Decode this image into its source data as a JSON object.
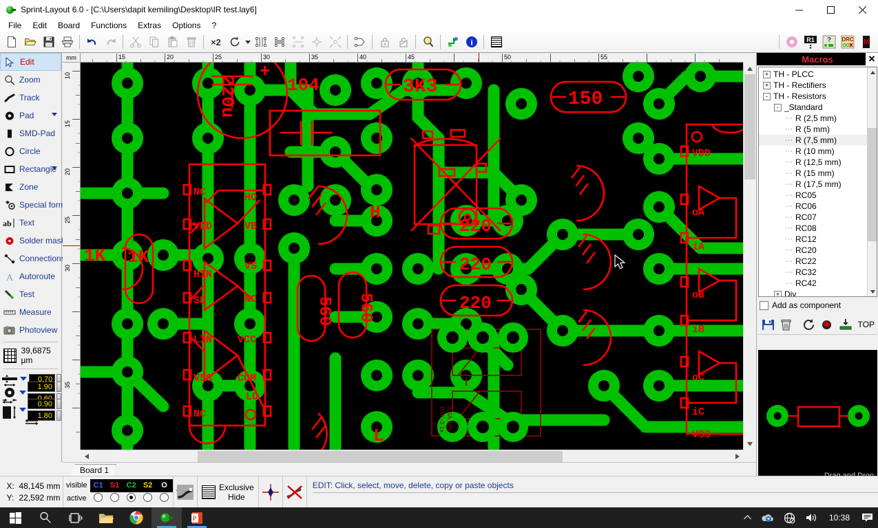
{
  "window": {
    "title": "Sprint-Layout 6.0 - [C:\\Users\\dapit kemiling\\Desktop\\IR test.lay6]",
    "minimize": "–",
    "maximize": "❐",
    "close": "✕"
  },
  "menu": [
    "File",
    "Edit",
    "Board",
    "Functions",
    "Extras",
    "Options",
    "?"
  ],
  "toolbar": {
    "buttons": [
      {
        "name": "new-file-icon",
        "tip": "New"
      },
      {
        "name": "open-file-icon",
        "tip": "Open"
      },
      {
        "name": "save-file-icon",
        "tip": "Save"
      },
      {
        "name": "print-icon",
        "tip": "Print"
      },
      {
        "name": "undo-icon",
        "tip": "Undo"
      },
      {
        "name": "redo-icon",
        "tip": "Redo"
      },
      {
        "name": "cut-icon",
        "tip": "Cut"
      },
      {
        "name": "copy-icon",
        "tip": "Copy"
      },
      {
        "name": "paste-icon",
        "tip": "Paste"
      },
      {
        "name": "delete-icon",
        "tip": "Delete"
      },
      {
        "name": "duplicate-x2-icon",
        "tip": "×2"
      },
      {
        "name": "rotate-icon",
        "tip": "Rotate"
      },
      {
        "name": "mirror-horizontal-icon",
        "tip": "Mirror horizontal"
      },
      {
        "name": "mirror-vertical-icon",
        "tip": "Mirror vertical"
      },
      {
        "name": "align-icon",
        "tip": "Align"
      },
      {
        "name": "flatten-icon",
        "tip": "Flatten"
      },
      {
        "name": "center-icon",
        "tip": "Center"
      },
      {
        "name": "group-icon",
        "tip": "Group"
      },
      {
        "name": "lock-icon",
        "tip": "Lock"
      },
      {
        "name": "unlock-icon",
        "tip": "Unlock"
      },
      {
        "name": "zoom-icon",
        "tip": "Zoom"
      },
      {
        "name": "crop-board-icon",
        "tip": "Board outline"
      },
      {
        "name": "info-icon",
        "tip": "Info"
      },
      {
        "name": "ground-plane-icon",
        "tip": "Ground plane"
      }
    ],
    "right_buttons": [
      {
        "name": "solder-mask-icon",
        "label": ""
      },
      {
        "name": "component-r1-icon",
        "label": "R1"
      },
      {
        "name": "help-test-icon",
        "label": "?"
      },
      {
        "name": "drc-icon",
        "label": "DRC"
      },
      {
        "name": "m-marker-icon",
        "label": "M"
      }
    ],
    "x2_label": "×2"
  },
  "tools": {
    "items": [
      {
        "label": "Edit",
        "icon": "cursor-arrow-icon",
        "selected": true,
        "caret": false
      },
      {
        "label": "Zoom",
        "icon": "magnifier-icon",
        "selected": false,
        "caret": false
      },
      {
        "label": "Track",
        "icon": "track-icon",
        "selected": false,
        "caret": false
      },
      {
        "label": "Pad",
        "icon": "pad-icon",
        "selected": false,
        "caret": true
      },
      {
        "label": "SMD-Pad",
        "icon": "smd-pad-icon",
        "selected": false,
        "caret": false
      },
      {
        "label": "Circle",
        "icon": "circle-icon",
        "selected": false,
        "caret": false
      },
      {
        "label": "Rectangle",
        "icon": "rectangle-icon",
        "selected": false,
        "caret": true
      },
      {
        "label": "Zone",
        "icon": "zone-icon",
        "selected": false,
        "caret": false
      },
      {
        "label": "Special form",
        "icon": "special-form-icon",
        "selected": false,
        "caret": false
      },
      {
        "label": "Text",
        "icon": "text-ab-icon",
        "selected": false,
        "caret": false
      },
      {
        "label": "Solder mask",
        "icon": "solder-mask-dot-icon",
        "selected": false,
        "caret": false
      },
      {
        "label": "Connections",
        "icon": "connections-icon",
        "selected": false,
        "caret": false
      },
      {
        "label": "Autoroute",
        "icon": "autoroute-a-icon",
        "selected": false,
        "caret": false
      },
      {
        "label": "Test",
        "icon": "test-probe-icon",
        "selected": false,
        "caret": false
      },
      {
        "label": "Measure",
        "icon": "measure-ruler-icon",
        "selected": false,
        "caret": false
      },
      {
        "label": "Photoview",
        "icon": "photoview-camera-icon",
        "selected": false,
        "caret": false
      }
    ],
    "grid_value": "39,6875 µm",
    "values": [
      {
        "icon": "track-width-icon",
        "fields": [
          "0.70"
        ]
      },
      {
        "icon": "pad-size-icon",
        "fields": [
          "1.90",
          "0.60"
        ]
      },
      {
        "icon": "smd-size-icon",
        "fields": [
          "0.90",
          "1.80"
        ]
      }
    ],
    "swap_icon": "swap-arrows-icon"
  },
  "ruler": {
    "unit": "mm",
    "h_labels": [
      "15",
      "20",
      "25",
      "30",
      "35",
      "40",
      "45",
      "50",
      "55"
    ],
    "v_labels": [
      "10",
      "15",
      "20",
      "25",
      "30",
      "35"
    ]
  },
  "macros": {
    "title": "Macros",
    "close": "✕",
    "tree": [
      {
        "label": "TH - PLCC",
        "depth": 1,
        "expander": "+"
      },
      {
        "label": "TH - Rectifiers",
        "depth": 1,
        "expander": "+"
      },
      {
        "label": "TH - Resistors",
        "depth": 1,
        "expander": "-"
      },
      {
        "label": "_Standard",
        "depth": 2,
        "expander": "-"
      },
      {
        "label": "R (2,5 mm)",
        "depth": 3,
        "expander": ""
      },
      {
        "label": "R (5 mm)",
        "depth": 3,
        "expander": ""
      },
      {
        "label": "R (7,5 mm)",
        "depth": 3,
        "expander": "",
        "selected": true
      },
      {
        "label": "R (10 mm)",
        "depth": 3,
        "expander": ""
      },
      {
        "label": "R (12,5 mm)",
        "depth": 3,
        "expander": ""
      },
      {
        "label": "R (15 mm)",
        "depth": 3,
        "expander": ""
      },
      {
        "label": "R (17,5 mm)",
        "depth": 3,
        "expander": ""
      },
      {
        "label": "RC05",
        "depth": 3,
        "expander": ""
      },
      {
        "label": "RC06",
        "depth": 3,
        "expander": ""
      },
      {
        "label": "RC07",
        "depth": 3,
        "expander": ""
      },
      {
        "label": "RC08",
        "depth": 3,
        "expander": ""
      },
      {
        "label": "RC12",
        "depth": 3,
        "expander": ""
      },
      {
        "label": "RC20",
        "depth": 3,
        "expander": ""
      },
      {
        "label": "RC22",
        "depth": 3,
        "expander": ""
      },
      {
        "label": "RC32",
        "depth": 3,
        "expander": ""
      },
      {
        "label": "RC42",
        "depth": 3,
        "expander": ""
      },
      {
        "label": "Div",
        "depth": 2,
        "expander": "+"
      }
    ],
    "add_as_component": "Add as component",
    "buttons": [
      {
        "name": "save-macro-icon"
      },
      {
        "name": "delete-macro-icon"
      },
      {
        "name": "rotate-macro-icon"
      },
      {
        "name": "record-macro-icon"
      },
      {
        "name": "place-macro-icon"
      }
    ],
    "side_label": "TOP",
    "preview_hint": "Drag and Drop"
  },
  "tabs": {
    "board": "Board 1"
  },
  "status": {
    "x_label": "X:",
    "x_value": "48,145 mm",
    "y_label": "Y:",
    "y_value": "22,592 mm",
    "visible_label": "visible",
    "active_label": "active",
    "layers": [
      {
        "name": "C1",
        "color": "#3b6cff",
        "active": false
      },
      {
        "name": "S1",
        "color": "#ff2020",
        "active": false
      },
      {
        "name": "C2",
        "color": "#28c028",
        "active": true
      },
      {
        "name": "S2",
        "color": "#ffd000",
        "active": false
      },
      {
        "name": "O",
        "color": "#ffffff",
        "active": false
      }
    ],
    "question": "?",
    "exclusive_hide": "Exclusive\nHide",
    "exclusive_line1": "Exclusive",
    "exclusive_line2": "Hide",
    "hint": "EDIT:  Click, select, move, delete, copy or paste objects"
  },
  "taskbar": {
    "items": [
      {
        "name": "start-button-icon",
        "active": false,
        "underline": false
      },
      {
        "name": "search-icon",
        "active": false,
        "underline": false
      },
      {
        "name": "task-view-icon",
        "active": false,
        "underline": false
      },
      {
        "name": "file-explorer-icon",
        "active": false,
        "underline": false
      },
      {
        "name": "chrome-icon",
        "active": false,
        "underline": false
      },
      {
        "name": "sprint-layout-icon",
        "active": true,
        "underline": true
      },
      {
        "name": "powerpoint-icon",
        "active": false,
        "underline": true
      }
    ],
    "tray": [
      {
        "name": "show-hidden-icons-chevron"
      },
      {
        "name": "onedrive-icon"
      },
      {
        "name": "network-offline-icon"
      },
      {
        "name": "volume-icon"
      }
    ],
    "clock": "10:38",
    "notification": "notification-center-icon"
  },
  "pcb": {
    "colors": {
      "background": "#000000",
      "copper_green": "#00c000",
      "silkscreen_red": "#ff0000",
      "silk_dark_red": "#a00000"
    },
    "silkscreen_texts": [
      "220u",
      "104",
      "3K3",
      "150",
      "1K",
      "1K",
      "220",
      "220",
      "220",
      "560",
      "560",
      "H",
      "L",
      "+",
      "NC",
      "VDD",
      "HIN",
      "SD",
      "LIN",
      "VSS",
      "NC",
      "HO",
      "VB",
      "VS",
      "NC",
      "VCC",
      "COM",
      "LO",
      "VDD",
      "oA",
      "iA",
      "oB",
      "iB",
      "oC",
      "iC",
      "VSS",
      "PSK-3 1x",
      "0.3A 30V"
    ]
  }
}
